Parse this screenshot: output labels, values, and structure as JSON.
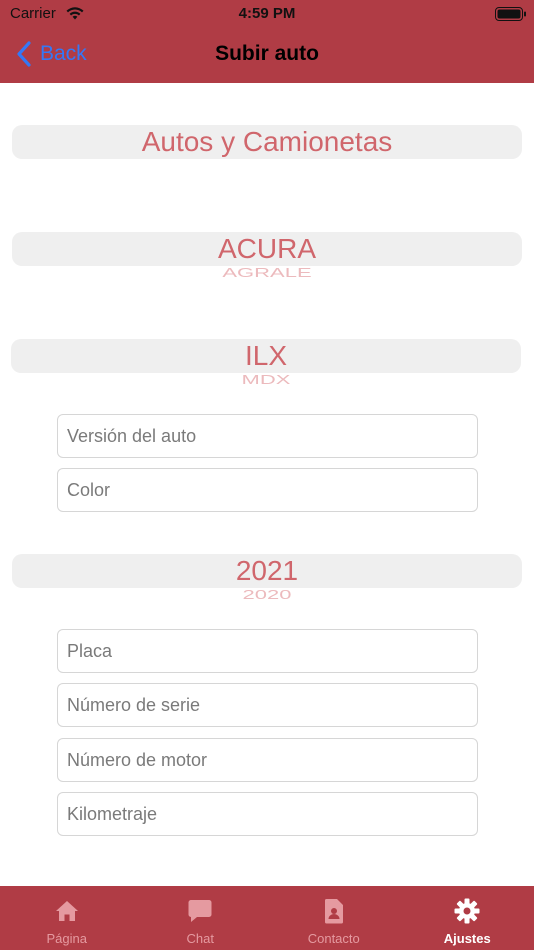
{
  "status_bar": {
    "carrier": "Carrier",
    "time": "4:59 PM"
  },
  "nav": {
    "back_label": "Back",
    "title": "Subir auto"
  },
  "pickers": {
    "category": {
      "selected": "Autos y Camionetas"
    },
    "brand": {
      "selected": "ACURA",
      "next": "AGRALE"
    },
    "model": {
      "selected": "ILX",
      "next": "MDX"
    },
    "year": {
      "selected": "2021",
      "next": "2020"
    }
  },
  "form": {
    "version_placeholder": "Versión del auto",
    "color_placeholder": "Color",
    "plate_placeholder": "Placa",
    "serial_placeholder": "Número de serie",
    "engine_placeholder": "Número de motor",
    "mileage_placeholder": "Kilometraje"
  },
  "tabs": [
    {
      "label": "Página",
      "icon": "home-icon"
    },
    {
      "label": "Chat",
      "icon": "chat-icon"
    },
    {
      "label": "Contacto",
      "icon": "contact-icon"
    },
    {
      "label": "Ajustes",
      "icon": "gear-icon",
      "active": true
    }
  ],
  "colors": {
    "header": "#b03c45",
    "picker_text": "#d0666c",
    "back_link": "#3478f6",
    "tab_inactive": "#e59aa0",
    "tab_active": "#ffffff"
  }
}
